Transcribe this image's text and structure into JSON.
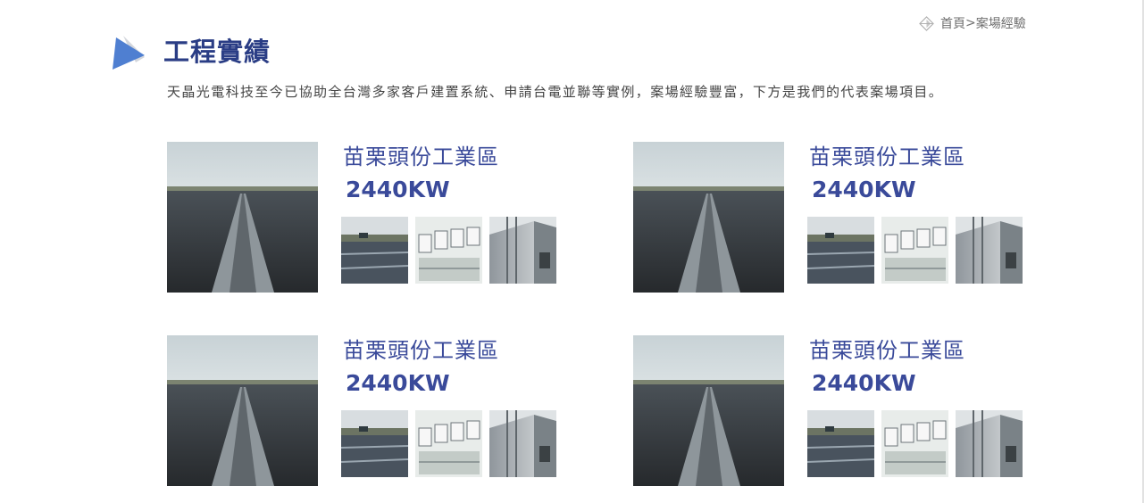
{
  "breadcrumb": {
    "icon": "diamond-home-icon",
    "home": "首頁",
    "separator": ">",
    "current": "案場經驗"
  },
  "header": {
    "icon": "triangle-title-icon",
    "title": "工程實績",
    "intro": "天晶光電科技至今已協助全台灣多家客戶建置系統、申請台電並聯等實例，案場經驗豐富，下方是我們的代表案場項目。"
  },
  "colors": {
    "title": "#2a3d85",
    "site_text": "#3a4a9a",
    "icon_blue": "#4f7fd1"
  },
  "projects": [
    {
      "name": "苗栗頭份工業區",
      "capacity": "2440KW",
      "main_image": "rooftop-solar-array-photo",
      "thumbnails": [
        "solar-panel-closeup-photo",
        "inverter-cabinets-photo",
        "metal-ladder-building-photo"
      ]
    },
    {
      "name": "苗栗頭份工業區",
      "capacity": "2440KW",
      "main_image": "rooftop-solar-array-photo",
      "thumbnails": [
        "solar-panel-closeup-photo",
        "inverter-cabinets-photo",
        "metal-ladder-building-photo"
      ]
    },
    {
      "name": "苗栗頭份工業區",
      "capacity": "2440KW",
      "main_image": "rooftop-solar-array-photo",
      "thumbnails": [
        "solar-panel-closeup-photo",
        "inverter-cabinets-photo",
        "metal-ladder-building-photo"
      ]
    },
    {
      "name": "苗栗頭份工業區",
      "capacity": "2440KW",
      "main_image": "rooftop-solar-array-photo",
      "thumbnails": [
        "solar-panel-closeup-photo",
        "inverter-cabinets-photo",
        "metal-ladder-building-photo"
      ]
    }
  ]
}
